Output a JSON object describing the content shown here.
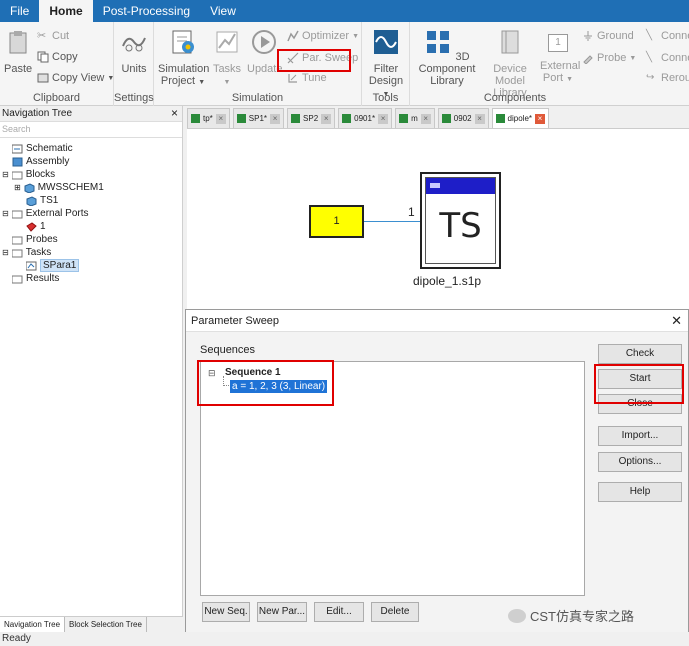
{
  "menu": {
    "items": [
      "File",
      "Home",
      "Post-Processing",
      "View"
    ],
    "active": "Home"
  },
  "ribbon": {
    "clipboard": {
      "label": "Clipboard",
      "paste": "Paste",
      "cut": "Cut",
      "copy": "Copy",
      "copy_view": "Copy View"
    },
    "settings": {
      "label": "Settings",
      "units": "Units"
    },
    "simulation": {
      "label": "Simulation",
      "project_line1": "Simulation",
      "project_line2": "Project",
      "tasks": "Tasks",
      "update": "Update",
      "optimizer": "Optimizer",
      "par_sweep": "Par. Sweep",
      "tune": "Tune"
    },
    "tools": {
      "label": "Tools",
      "filter_line1": "Filter",
      "filter_line2": "Design"
    },
    "components": {
      "label": "Components",
      "lib_line1": "3D Component",
      "lib_line2": "Library",
      "dev_line1": "Device Model",
      "dev_line2": "Library",
      "ext_line1": "External",
      "ext_line2": "Port",
      "ext_num": "1",
      "ground": "Ground",
      "probe": "Probe",
      "connect1": "Connec",
      "connect2": "Connec",
      "reroute": "Reroute"
    }
  },
  "nav": {
    "title": "Navigation Tree",
    "search_placeholder": "Search",
    "items": [
      "Schematic",
      "Assembly",
      "Blocks",
      "MWSSCHEM1",
      "TS1",
      "External Ports",
      "1",
      "Probes",
      "Tasks",
      "SPara1",
      "Results"
    ],
    "tabs": [
      "Navigation Tree",
      "Block Selection Tree"
    ]
  },
  "doc_tabs": [
    "tp*",
    "SP1*",
    "SP2",
    "0901*",
    "m",
    "0902",
    "dipole*"
  ],
  "canvas": {
    "port_value": "1",
    "port_pin": "1",
    "block_text": "TS",
    "block_name": "dipole_1.s1p"
  },
  "dialog": {
    "title": "Parameter Sweep",
    "sequences_label": "Sequences",
    "sequence_name": "Sequence 1",
    "sequence_item": "a = 1, 2, 3 (3, Linear)",
    "buttons": {
      "check": "Check",
      "start": "Start",
      "close": "Close",
      "import": "Import...",
      "options": "Options...",
      "help": "Help",
      "new_seq": "New Seq.",
      "new_par": "New Par...",
      "edit": "Edit...",
      "delete": "Delete"
    }
  },
  "status": "Ready",
  "watermark": "CST仿真专家之路",
  "colors": {
    "menubar": "#1f6fb5",
    "highlight": "#e00000",
    "selection": "#1f73d6",
    "port_fill": "#ffff00",
    "block_bar": "#1e1ec8"
  }
}
